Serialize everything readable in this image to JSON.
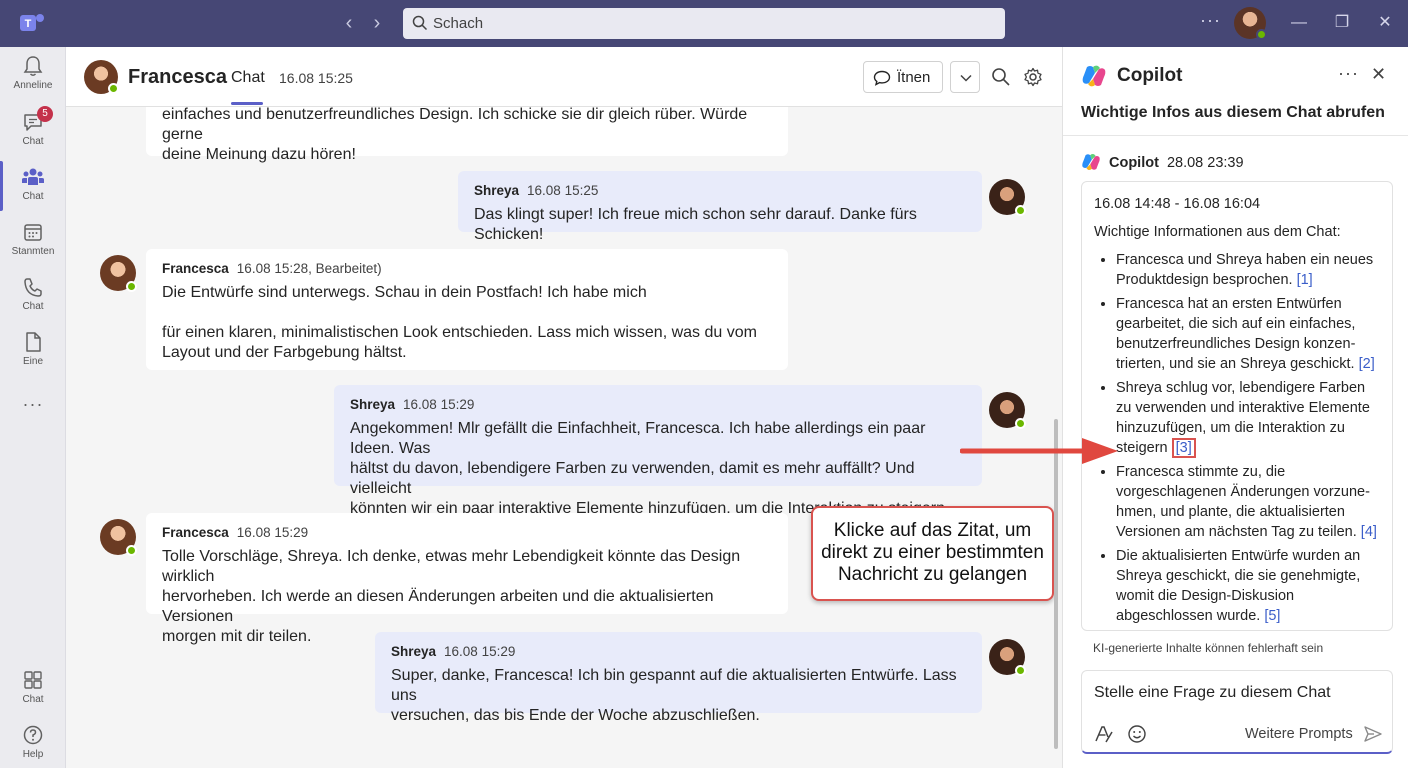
{
  "titlebar": {
    "search_placeholder": "Schach"
  },
  "rail": {
    "items": [
      {
        "label": "Anneline"
      },
      {
        "label": "Chat",
        "badge": "5"
      },
      {
        "label": "Chat"
      },
      {
        "label": "Stanmten"
      },
      {
        "label": "Chat"
      },
      {
        "label": "Eine"
      },
      {
        "label": "Chat"
      },
      {
        "label": "Help"
      }
    ]
  },
  "header": {
    "name": "Francesca",
    "tab": "Chat",
    "time": "16.08 15:25",
    "open_label": "Ïtnen"
  },
  "messages": [
    {
      "side": "in",
      "author": "",
      "time": "",
      "lines": [
        "einfaches und benutzerfreundliches Design. Ich schicke sie dir gleich rüber. Würde gerne",
        "deine Meinung dazu hören!"
      ]
    },
    {
      "side": "out",
      "author": "Shreya",
      "time": "16.08 15:25",
      "lines": [
        "Das klingt super! Ich freue mich schon sehr darauf. Danke fürs Schicken!"
      ]
    },
    {
      "side": "in",
      "author": "Francesca",
      "time": "16.08 15:28, Bearbeitet)",
      "lines": [
        "Die Entwürfe sind unterwegs. Schau in dein Postfach! Ich habe mich",
        "",
        "für einen klaren, minimalistischen Look entschieden. Lass mich wissen, was du vom",
        "Layout und der Farbgebung hältst."
      ]
    },
    {
      "side": "out",
      "author": "Shreya",
      "time": "16.08 15:29",
      "lines": [
        "Angekommen! Mlr gefällt die Einfachheit, Francesca. Ich habe allerdings ein paar Ideen. Was",
        "hältst du davon, lebendigere Farben zu verwenden, damit es mehr auffällt? Und vielleicht",
        "könnten wir ein paar interaktive Elemente hinzufügen, um die Interaktion zu steigern."
      ]
    },
    {
      "side": "in",
      "author": "Francesca",
      "time": "16.08 15:29",
      "lines": [
        "Tolle Vorschläge, Shreya. Ich denke, etwas mehr Lebendigkeit könnte das Design wirklich",
        "hervorheben. Ich werde an diesen Änderungen arbeiten und die aktualisierten Versionen",
        "morgen mit dir teilen."
      ]
    },
    {
      "side": "out",
      "author": "Shreya",
      "time": "16.08 15:29",
      "lines": [
        "Super, danke, Francesca! Ich bin gespannt auf die aktualisierten Entwürfe. Lass uns",
        "versuchen, das bis Ende der Woche abzuschließen."
      ]
    }
  ],
  "annotation": {
    "lines": [
      "Klicke auf das Zitat, um",
      "direkt zu einer bestimmten",
      "Nachricht zu gelangen"
    ]
  },
  "copilot": {
    "title": "Copilot",
    "subtitle": "Wichtige Infos aus diesem Chat abrufen",
    "author": "Copilot",
    "time": "28.08 23:39",
    "range": "16.08 14:48 - 16.08 16:04",
    "intro": "Wichtige Informationen aus dem Chat:",
    "bullets": [
      {
        "text": "Francesca und Shreya haben ein neues Produktdesign besprochen.",
        "cite": "[1]"
      },
      {
        "text": "Francesca hat an ersten Entwürfen gearbeitet, die sich auf ein einfaches, benutzerfreundliches Design konzen-trierten, und sie an Shreya geschickt.",
        "cite": "[2]"
      },
      {
        "text": "Shreya schlug vor, lebendigere Farben zu verwenden und interaktive Elemente hinzuzufügen, um die Interaktion zu steigern",
        "cite": "[3]"
      },
      {
        "text": "Francesca stimmte zu, die vorgeschlagenen Änderungen vorzune-hmen, und plante, die aktualisierten Versionen am nächsten Tag zu teilen.",
        "cite": "[4]"
      },
      {
        "text": "Die aktualisierten Entwürfe wurden an Shreya geschickt, die sie genehmigte, womit die Design-Diskusion abgeschlossen wurde.",
        "cite": "[5]"
      }
    ],
    "disclaimer": "KI-generierte Inhalte können fehlerhaft sein",
    "input_placeholder": "Stelle eine Frage zu diesem Chat",
    "more_prompts": "Weitere Prompts"
  },
  "colors": {
    "titlebar": "#464775",
    "accent": "#5b5fc7",
    "outgoing_bubble": "#e8ebfa",
    "annotation_border": "#d9534f",
    "presence": "#6bb700"
  }
}
